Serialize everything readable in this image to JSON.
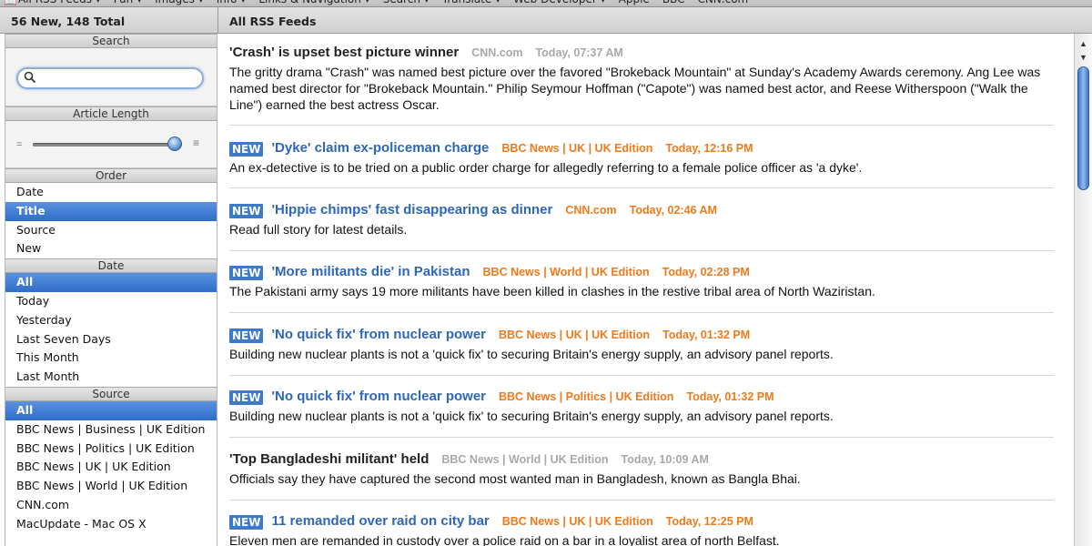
{
  "bookmarks": {
    "items": [
      "All RSS Feeds ▾",
      "Fun ▾",
      "Images ▾",
      "Info ▾",
      "Links & Navigation ▾",
      "Search ▾",
      "Translate ▾",
      "Web Developer ▾",
      "Apple",
      "BBC",
      "CNN.com"
    ]
  },
  "header": {
    "count": "56 New, 148 Total",
    "feed_title": "All RSS Feeds"
  },
  "sidebar": {
    "search": {
      "heading": "Search",
      "value": "",
      "placeholder": ""
    },
    "length": {
      "heading": "Article Length",
      "min_glyph": "=",
      "max_glyph": "≡",
      "level": 0.95
    },
    "order": {
      "heading": "Order",
      "items": [
        "Date",
        "Title",
        "Source",
        "New"
      ],
      "selected": "Title"
    },
    "date": {
      "heading": "Date",
      "items": [
        "All",
        "Today",
        "Yesterday",
        "Last Seven Days",
        "This Month",
        "Last Month"
      ],
      "selected": "All"
    },
    "source": {
      "heading": "Source",
      "items": [
        "All",
        "BBC News | Business | UK Edition",
        "BBC News | Politics | UK Edition",
        "BBC News | UK | UK Edition",
        "BBC News | World | UK Edition",
        "CNN.com",
        "MacUpdate - Mac OS X"
      ],
      "selected": "All"
    }
  },
  "articles": [
    {
      "new": false,
      "title": "'Crash' is upset best picture winner",
      "source": "CNN.com",
      "date": "Today, 07:37 AM",
      "description": "The gritty drama \"Crash\" was named best picture over the favored \"Brokeback Mountain\" at Sunday's Academy Awards ceremony. Ang Lee was named best director for \"Brokeback Mountain.\" Philip Seymour Hoffman (\"Capote\") was named best actor, and Reese Witherspoon (\"Walk the Line\") earned the best actress Oscar."
    },
    {
      "new": true,
      "badge": "NEW",
      "title": "'Dyke' claim ex-policeman charge",
      "source": "BBC News | UK | UK Edition",
      "date": "Today, 12:16 PM",
      "description": "An ex-detective is to be tried on a public order charge for allegedly referring to a female police officer as 'a dyke'."
    },
    {
      "new": true,
      "badge": "NEW",
      "title": "'Hippie chimps' fast disappearing as dinner",
      "source": "CNN.com",
      "date": "Today, 02:46 AM",
      "description": "Read full story for latest details."
    },
    {
      "new": true,
      "badge": "NEW",
      "title": "'More militants die' in Pakistan",
      "source": "BBC News | World | UK Edition",
      "date": "Today, 02:28 PM",
      "description": "The Pakistani army says 19 more militants have been killed in clashes in the restive tribal area of North Waziristan."
    },
    {
      "new": true,
      "badge": "NEW",
      "title": "'No quick fix' from nuclear power",
      "source": "BBC News | UK | UK Edition",
      "date": "Today, 01:32 PM",
      "description": "Building new nuclear plants is not a 'quick fix' to securing Britain's energy supply, an advisory panel reports."
    },
    {
      "new": true,
      "badge": "NEW",
      "title": "'No quick fix' from nuclear power",
      "source": "BBC News | Politics | UK Edition",
      "date": "Today, 01:32 PM",
      "description": "Building new nuclear plants is not a 'quick fix' to securing Britain's energy supply, an advisory panel reports."
    },
    {
      "new": false,
      "title": "'Top Bangladeshi militant' held",
      "source": "BBC News | World | UK Edition",
      "date": "Today, 10:09 AM",
      "description": "Officials say they have captured the second most wanted man in Bangladesh, known as Bangla Bhai."
    },
    {
      "new": true,
      "badge": "NEW",
      "title": "11 remanded over raid on city bar",
      "source": "BBC News | UK | UK Edition",
      "date": "Today, 12:25 PM",
      "description": "Eleven men are remanded in custody over a police raid on a bar in a loyalist area of north Belfast."
    }
  ],
  "scrollbar": {
    "up_arrow": "▲",
    "down_arrow": "▼"
  },
  "colors": {
    "accent": "#3d7bc8",
    "source_new": "#f07a1a",
    "source_read": "#a8a8a8",
    "title_new": "#2e66b8"
  }
}
